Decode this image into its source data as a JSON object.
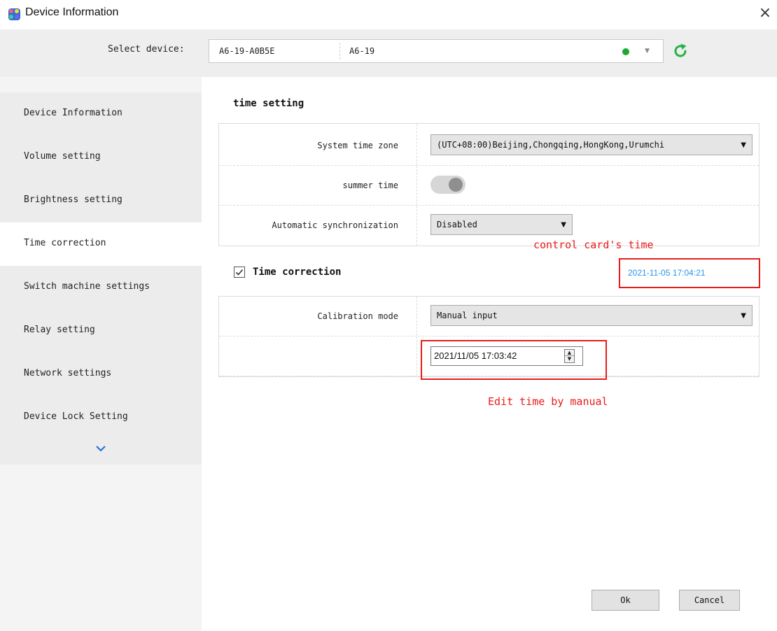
{
  "window": {
    "title": "Device Information",
    "close_glyph": "×"
  },
  "device_bar": {
    "label": "Select device:",
    "device_id": "A6-19-A0B5E",
    "device_name": "A6-19",
    "status_color": "#1ea72f",
    "dropdown_arrow": "▼"
  },
  "sidebar": {
    "items": [
      {
        "label": "Device Information"
      },
      {
        "label": "Volume setting"
      },
      {
        "label": "Brightness setting"
      },
      {
        "label": "Time correction"
      },
      {
        "label": "Switch machine settings"
      },
      {
        "label": "Relay setting"
      },
      {
        "label": "Network settings"
      },
      {
        "label": "Device Lock Setting"
      }
    ],
    "active_index": 3
  },
  "time_setting": {
    "title": "time setting",
    "timezone_label": "System time zone",
    "timezone_value": "(UTC+08:00)Beijing,Chongqing,HongKong,Urumchi",
    "summer_label": "summer time",
    "summer_on": false,
    "autosync_label": "Automatic synchronization",
    "autosync_value": "Disabled"
  },
  "time_correction": {
    "label": "Time correction",
    "checked": true,
    "check_glyph": "✓",
    "card_time": "2021-11-05 17:04:21",
    "calibration_label": "Calibration mode",
    "calibration_value": "Manual input",
    "manual_time": "2021/11/05 17:03:42",
    "spin_up": "▲",
    "spin_down": "▼"
  },
  "annotations": {
    "card_time_note": "control card's time",
    "edit_note": "Edit time by manual",
    "color": "#ea1b1b"
  },
  "buttons": {
    "ok": "Ok",
    "cancel": "Cancel"
  },
  "colors": {
    "accent_blue": "#2a95e8",
    "refresh_green": "#27b14a"
  }
}
